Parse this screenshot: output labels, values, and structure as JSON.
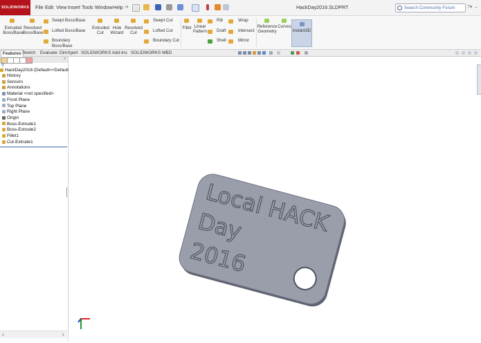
{
  "app": {
    "logo": "SOLIDWORKS",
    "menus": [
      "File",
      "Edit",
      "View",
      "Insert",
      "Tools",
      "Window",
      "Help"
    ],
    "document_title": "HackDay2016.SLDPRT",
    "search_placeholder": "Search Community Forum"
  },
  "commands": {
    "extruded_boss": [
      "Extruded",
      "Boss/Base"
    ],
    "revolved_boss": [
      "Revolved",
      "Boss/Base"
    ],
    "swept_boss": "Swept Boss/Base",
    "lofted_boss": "Lofted Boss/Base",
    "boundary_boss": "Boundary Boss/Base",
    "extruded_cut": [
      "Extruded",
      "Cut"
    ],
    "hole_wizard": [
      "Hole",
      "Wizard"
    ],
    "revolved_cut": [
      "Revolved",
      "Cut"
    ],
    "swept_cut": "Swept Cut",
    "lofted_cut": "Lofted Cut",
    "boundary_cut": "Boundary Cut",
    "fillet": "Fillet",
    "linear_pattern": [
      "Linear",
      "Pattern"
    ],
    "rib": "Rib",
    "draft": "Draft",
    "shell": "Shell",
    "wrap": "Wrap",
    "intersect": "Intersect",
    "mirror": "Mirror",
    "reference_geometry": [
      "Reference",
      "Geometry"
    ],
    "curves": "Curves",
    "instant3d": "Instant3D"
  },
  "tabs": [
    "Features",
    "Sketch",
    "Evaluate",
    "DimXpert",
    "SOLIDWORKS Add-Ins",
    "SOLIDWORKS MBD"
  ],
  "feature_tree": {
    "root": "HackDay2016  (Default<<Default",
    "items": [
      {
        "label": "History",
        "color": "#c8a040"
      },
      {
        "label": "Sensors",
        "color": "#c8a040"
      },
      {
        "label": "Annotations",
        "color": "#c8a040"
      },
      {
        "label": "Material <not specified>",
        "color": "#7b8fa8"
      },
      {
        "label": "Front Plane",
        "color": "#9ab0c8"
      },
      {
        "label": "Top Plane",
        "color": "#9ab0c8"
      },
      {
        "label": "Right Plane",
        "color": "#9ab0c8"
      },
      {
        "label": "Origin",
        "color": "#666666"
      },
      {
        "label": "Boss-Extrude1",
        "color": "#d6a936"
      },
      {
        "label": "Boss-Extrude2",
        "color": "#d6a936"
      },
      {
        "label": "Fillet1",
        "color": "#d6a936"
      },
      {
        "label": "Cut-Extrude1",
        "color": "#d6a936"
      }
    ]
  },
  "model": {
    "lines": [
      "Local HACK",
      "Day",
      "2016"
    ],
    "color": "#9a9eaa"
  },
  "colors": {
    "accent": "#b5121b",
    "rollback": "#3a63b8"
  }
}
